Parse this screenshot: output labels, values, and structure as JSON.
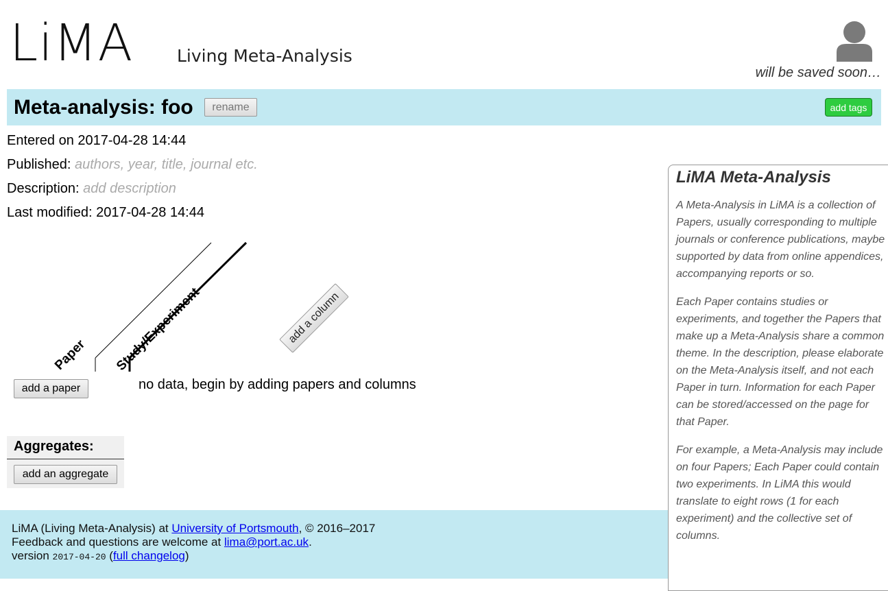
{
  "header": {
    "logo": "LiMA",
    "tagline": "Living Meta-Analysis",
    "save_status": "will be saved soon…"
  },
  "title_bar": {
    "title": "Meta-analysis: foo",
    "rename_label": "rename",
    "add_tags_label": "add tags"
  },
  "meta": {
    "entered_label": "Entered on",
    "entered_value": "2017-04-28 14:44",
    "published_label": "Published:",
    "published_placeholder": "authors, year, title, journal etc.",
    "description_label": "Description:",
    "description_placeholder": "add description",
    "modified_label": "Last modified:",
    "modified_value": "2017-04-28 14:44"
  },
  "table": {
    "col_paper": "Paper",
    "col_study": "Study/Experiment",
    "add_column_label": "add a column",
    "add_paper_label": "add a paper",
    "empty_message": "no data, begin by adding papers and columns"
  },
  "aggregates": {
    "title": "Aggregates:",
    "add_label": "add an aggregate"
  },
  "help": {
    "title": "LiMA Meta-Analysis",
    "paragraphs": [
      "A Meta-Analysis in LiMA is a collection of Papers, usually corresponding to multiple journals or conference publications, maybe supported by data from online appendices, accompanying reports or so.",
      "Each Paper contains studies or experiments, and together the Papers that make up a Meta-Analysis share a common theme. In the description, please elaborate on the Meta-Analysis itself, and not each Paper in turn. Information for each Paper can be stored/accessed on the page for that Paper.",
      "For example, a Meta-Analysis may include on four Papers; Each Paper could contain two experiments. In LiMA this would translate to eight rows (1 for each experiment) and the collective set of columns."
    ]
  },
  "footer": {
    "line1_prefix": "LiMA (Living Meta-Analysis) at",
    "university_link": "University of Portsmouth",
    "line1_suffix": ", © 2016–2017",
    "line2_prefix": "Feedback and questions are welcome at",
    "email_link": "lima@port.ac.uk",
    "line2_suffix": ".",
    "version_label": "version",
    "version_value": "2017-04-20",
    "changelog_link": "full changelog"
  },
  "colors": {
    "accent_band": "#c2e9f2",
    "tags_button": "#2ecc40",
    "link": "#0000ee"
  },
  "icons": {
    "user": "user-silhouette-icon"
  }
}
